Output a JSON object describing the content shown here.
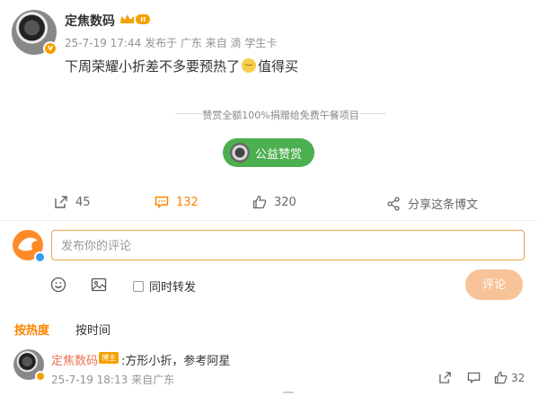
{
  "post": {
    "author": "定焦数码",
    "avatar_badge": "v",
    "meta": {
      "date": "25-7-19 17:44",
      "posted_from": "发布于 广东",
      "source": "来自 滴 学生卡"
    },
    "text_before_emoji": "下周荣耀小折差不多要预热了",
    "emoji": "doge-face",
    "text_after_emoji": "值得买",
    "donation": {
      "text": "赞赏全额100%捐赠给免费午餐项目",
      "button": "公益赞赏"
    },
    "actions": {
      "repost_count": "45",
      "comment_count": "132",
      "like_count": "320",
      "share_label": "分享这条博文"
    }
  },
  "composer": {
    "placeholder": "发布你的评论",
    "forward_label": "同时转发",
    "submit_label": "评论"
  },
  "sort_tabs": {
    "hot": "按热度",
    "time": "按时间"
  },
  "comment": {
    "author": "定焦数码",
    "tag": "博主",
    "text": ":方形小折，参考阿星",
    "date": "25-7-19 18:13",
    "source": "来自广东",
    "like_count": "32"
  },
  "colors": {
    "accent": "#ff8200",
    "donate_green": "#4caf50",
    "submit_disabled": "#f8c398",
    "input_border": "#f3a24c"
  },
  "icons": [
    "repost-icon",
    "comment-icon",
    "like-icon",
    "share-icon",
    "emoji-icon",
    "image-icon",
    "crown-icon"
  ]
}
